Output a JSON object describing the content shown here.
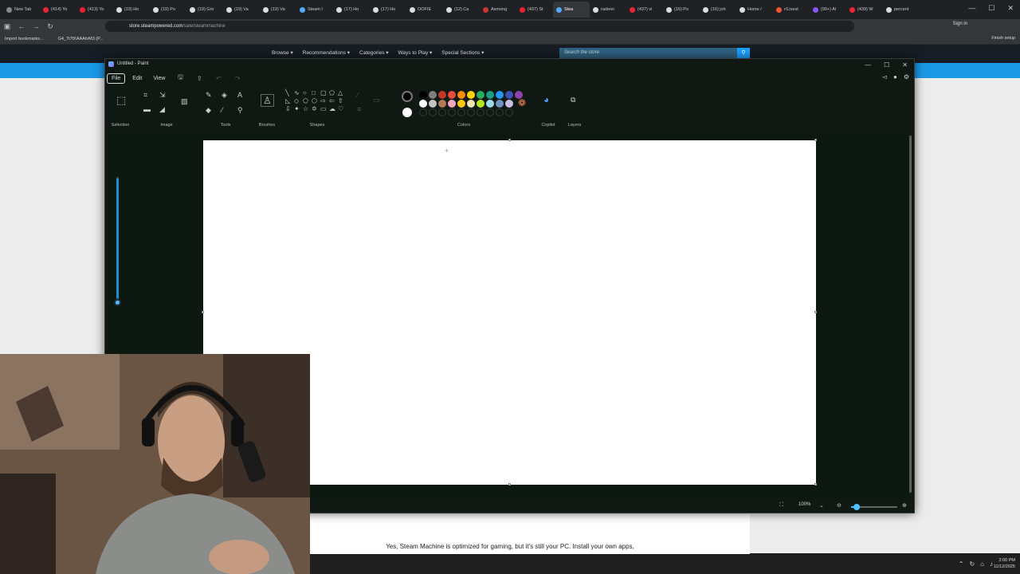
{
  "browser": {
    "tabs": [
      "New Tab",
      "(414) Yo",
      "(413) Yo",
      "(19) Ho",
      "(19) Po",
      "(19) Gro",
      "(19) Va",
      "(19) Va",
      "Steam I",
      "(17) Ho",
      "(17) Ho",
      "OOFIE",
      "(12) Ca",
      "Asmong",
      "(437) St",
      "Stea",
      "radeon",
      "(437) vi",
      "(16) Po",
      "(16) joh",
      "Home /",
      "r/Livest",
      "(99+) Al",
      "(439) W",
      "percent"
    ],
    "url_host": "store.steampowered.com",
    "url_path": "/sale/steammachine",
    "sign_in": "Sign in",
    "finish_setup": "Finish setup",
    "bookmarks": [
      "Import bookmarks...",
      "G4_7t7fXAAAtvM3 (P..."
    ]
  },
  "steam": {
    "menu": [
      "Browse ▾",
      "Recommendations ▾",
      "Categories ▾",
      "Ways to Play ▾",
      "Special Sections ▾"
    ],
    "search_placeholder": "Search the store",
    "body_text": "Yes, Steam Machine is optimized for gaming, but it's still your PC. Install your own apps,"
  },
  "paint": {
    "title": "Untitled - Paint",
    "menu": {
      "file": "File",
      "edit": "Edit",
      "view": "View"
    },
    "groups": {
      "selection": "Selection",
      "image": "Image",
      "tools": "Tools",
      "brushes": "Brushes",
      "shapes": "Shapes",
      "colors": "Colors",
      "copilot": "Copilot",
      "layers": "Layers"
    },
    "palette_row1": [
      "#000000",
      "#7f7f7f",
      "#c0392b",
      "#e74c3c",
      "#ff8c00",
      "#ffd200",
      "#27ae60",
      "#16a085",
      "#2196f3",
      "#3f51b5",
      "#8e44ad"
    ],
    "palette_row2": [
      "#ffffff",
      "#c3c3c3",
      "#b07a57",
      "#f4a6c0",
      "#ffc90e",
      "#eee5b0",
      "#b5e61d",
      "#99d9ea",
      "#7092be",
      "#c8bfe7"
    ],
    "zoom_label": "100%"
  },
  "taskbar": {
    "time": "2:00 PM",
    "date": "11/12/2025"
  }
}
